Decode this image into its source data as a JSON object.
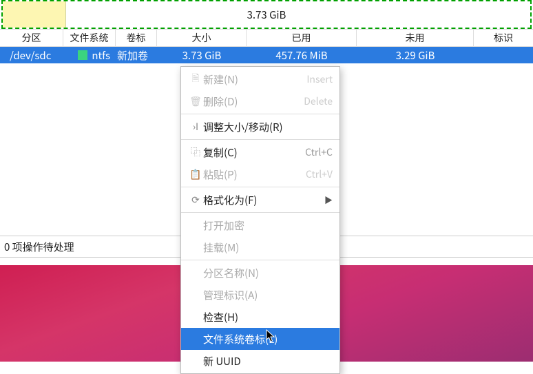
{
  "visual": {
    "size_label": "3.73 GiB"
  },
  "headers": {
    "partition": "分区",
    "filesystem": "文件系统",
    "label": "卷标",
    "size": "大小",
    "used": "已用",
    "free": "未用",
    "flags": "标识"
  },
  "row": {
    "partition": "/dev/sdc",
    "filesystem": "ntfs",
    "label": "新加卷",
    "size": "3.73 GiB",
    "used": "457.76 MiB",
    "free": "3.29 GiB"
  },
  "status": {
    "text": "0 项操作待处理"
  },
  "menu": {
    "new": {
      "label": "新建(N)",
      "accel": "Insert"
    },
    "delete": {
      "label": "删除(D)",
      "accel": "Delete"
    },
    "resize": {
      "label": "调整大小/移动(R)"
    },
    "copy": {
      "label": "复制(C)",
      "accel": "Ctrl+C"
    },
    "paste": {
      "label": "粘贴(P)",
      "accel": "Ctrl+V"
    },
    "format": {
      "label": "格式化为(F)"
    },
    "open_crypt": {
      "label": "打开加密"
    },
    "mount": {
      "label": "挂载(M)"
    },
    "part_name": {
      "label": "分区名称(N)"
    },
    "manage_flags": {
      "label": "管理标识(A)"
    },
    "check": {
      "label": "检查(H)"
    },
    "fs_label": {
      "label": "文件系统卷标(L)"
    },
    "new_uuid": {
      "label": "新 UUID"
    }
  },
  "colors": {
    "selection": "#2b7be0",
    "fs_ntfs": "#3bd47f"
  }
}
